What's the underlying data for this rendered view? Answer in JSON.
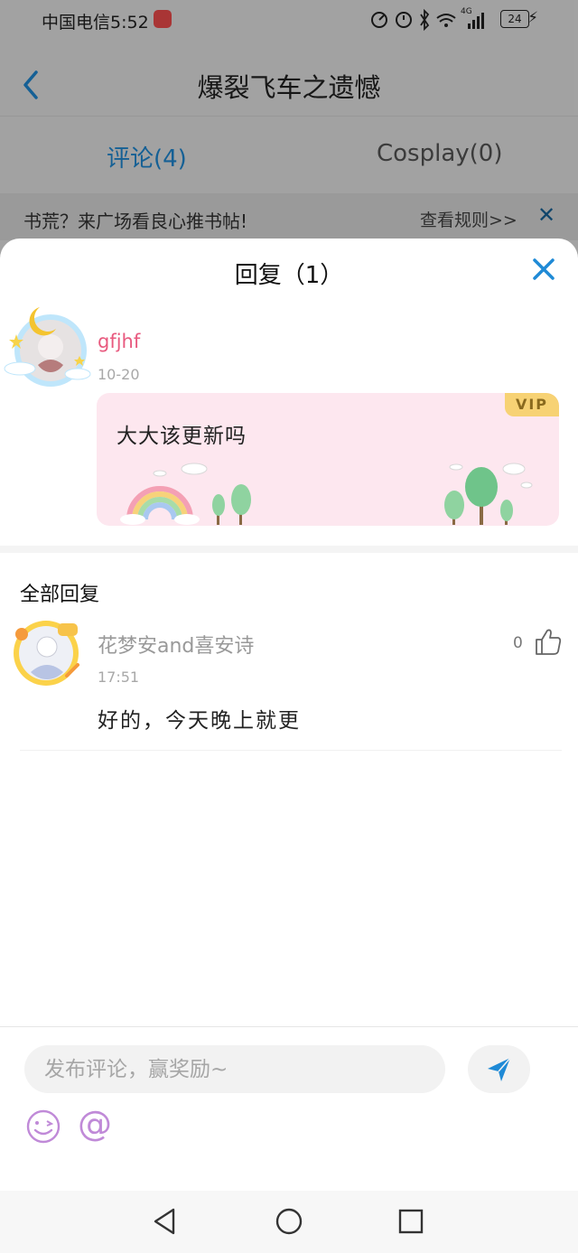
{
  "status_bar": {
    "carrier_time": "中国电信5:52",
    "network": "4G",
    "battery": "24"
  },
  "header": {
    "title": "爆裂飞车之遗憾",
    "tabs": [
      {
        "label": "评论(4)",
        "active": true
      },
      {
        "label": "Cosplay(0)",
        "active": false
      }
    ]
  },
  "banner": {
    "text": "书荒？来广场看良心推书帖!",
    "link": "查看规则>>",
    "close_icon": "close-icon"
  },
  "sheet": {
    "title": "回复（1）",
    "original_comment": {
      "username": "gfjhf",
      "date": "10-20",
      "badge": "VIP",
      "text": "大大该更新吗"
    },
    "section_label": "全部回复",
    "replies": [
      {
        "username": "花梦安and喜安诗",
        "time": "17:51",
        "text": "好的，今天晚上就更",
        "likes": "0"
      }
    ]
  },
  "composer": {
    "placeholder": "发布评论，赢奖励~",
    "at_symbol": "@"
  },
  "colors": {
    "accent_blue": "#1f8ad6",
    "username_pink": "#e85a7f",
    "bubble_bg": "#fde7ef",
    "vip_gold": "#f7d274",
    "emoji_purple": "#c08ad8"
  }
}
